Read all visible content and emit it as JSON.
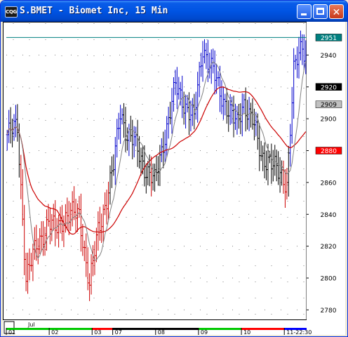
{
  "window": {
    "title": "S.BMET - Biomet Inc, 15 Min",
    "icon_label": "CQG",
    "icon": "cqg-app-icon",
    "buttons": [
      "minimize-icon",
      "maximize-icon",
      "close-icon"
    ],
    "close_glyph": "✕"
  },
  "chart_data": {
    "type": "line",
    "title": "S.BMET - Biomet Inc, 15 Min",
    "ylim": [
      2774,
      2960
    ],
    "y_ticks": [
      2940,
      2920,
      2900,
      2880,
      2860,
      2840,
      2820,
      2800,
      2780
    ],
    "price_tags": [
      {
        "label": "2951",
        "value": 2951,
        "bg": "#008080",
        "fg": "#ffffff"
      },
      {
        "label": "2920",
        "value": 2920,
        "bg": "#000000",
        "fg": "#ffffff"
      },
      {
        "label": "2909",
        "value": 2909,
        "bg": "#c0c0c0",
        "fg": "#000000"
      },
      {
        "label": "2880",
        "value": 2880,
        "bg": "#ff0000",
        "fg": "#ffffff"
      }
    ],
    "reference_line": {
      "value": 2951,
      "color": "#008080"
    },
    "x_month_label": "Jul",
    "day_labels": [
      "01",
      "02",
      "03",
      "07",
      "08",
      "09",
      "10",
      "11-22:30"
    ],
    "day_start_bars": [
      0,
      25,
      50,
      62,
      87,
      112,
      137,
      162
    ],
    "bar_count": 175,
    "x_band_colors": [
      "#00c800",
      "#00c800",
      "#ff0000",
      "#000000",
      "#000000",
      "#00c800",
      "#ff0000",
      "#0000ff"
    ],
    "colors": {
      "up": "#0000cc",
      "down": "#cc0000",
      "neutral": "#000000",
      "ma_fast": "#808080",
      "ma_slow": "#cc0000",
      "grid": "#808080"
    },
    "price_anchors": [
      [
        0,
        2890
      ],
      [
        6,
        2895
      ],
      [
        11,
        2800
      ],
      [
        17,
        2820
      ],
      [
        24,
        2835
      ],
      [
        28,
        2830
      ],
      [
        33,
        2838
      ],
      [
        37,
        2840
      ],
      [
        42,
        2840
      ],
      [
        48,
        2795
      ],
      [
        53,
        2830
      ],
      [
        58,
        2850
      ],
      [
        62,
        2870
      ],
      [
        66,
        2905
      ],
      [
        70,
        2890
      ],
      [
        74,
        2885
      ],
      [
        80,
        2870
      ],
      [
        86,
        2860
      ],
      [
        92,
        2890
      ],
      [
        98,
        2920
      ],
      [
        103,
        2910
      ],
      [
        109,
        2900
      ],
      [
        114,
        2945
      ],
      [
        120,
        2930
      ],
      [
        124,
        2915
      ],
      [
        130,
        2905
      ],
      [
        134,
        2895
      ],
      [
        138,
        2910
      ],
      [
        143,
        2900
      ],
      [
        148,
        2875
      ],
      [
        153,
        2875
      ],
      [
        158,
        2865
      ],
      [
        163,
        2860
      ],
      [
        167,
        2930
      ],
      [
        172,
        2945
      ],
      [
        176,
        2935
      ],
      [
        181,
        2925
      ],
      [
        186,
        2910
      ],
      [
        190,
        2918
      ]
    ]
  }
}
